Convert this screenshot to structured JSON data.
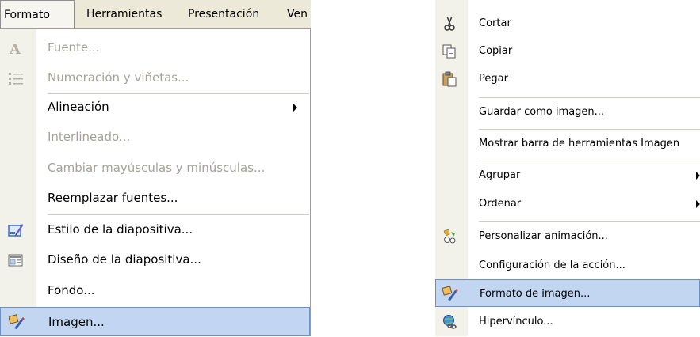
{
  "menubar": {
    "items": [
      "Formato",
      "Herramientas",
      "Presentación",
      "Ven"
    ]
  },
  "formato_menu": {
    "items": [
      {
        "label": "Fuente...",
        "icon": "font-A-icon",
        "disabled": true
      },
      {
        "label": "Numeración y viñetas...",
        "icon": "bullets-icon",
        "disabled": true
      },
      {
        "label": "Alineación",
        "submenu": true
      },
      {
        "label": "Interlineado...",
        "disabled": true
      },
      {
        "label": "Cambiar mayúsculas y minúsculas...",
        "disabled": true
      },
      {
        "label": "Reemplazar fuentes..."
      },
      {
        "label": "Estilo de la diapositiva...",
        "icon": "slide-style-icon"
      },
      {
        "label": "Diseño de la diapositiva...",
        "icon": "slide-layout-icon"
      },
      {
        "label": "Fondo..."
      },
      {
        "label": "Imagen...",
        "icon": "format-picture-icon",
        "highlighted": true
      }
    ]
  },
  "context_menu": {
    "items": [
      {
        "label": "Cortar",
        "icon": "scissors-icon"
      },
      {
        "label": "Copiar",
        "icon": "copy-icon"
      },
      {
        "label": "Pegar",
        "icon": "paste-icon"
      },
      {
        "label": "Guardar como imagen..."
      },
      {
        "label": "Mostrar barra de herramientas Imagen"
      },
      {
        "label": "Agrupar",
        "submenu": true
      },
      {
        "label": "Ordenar",
        "submenu": true
      },
      {
        "label": "Personalizar animación...",
        "icon": "custom-animation-icon"
      },
      {
        "label": "Configuración de la acción..."
      },
      {
        "label": "Formato de imagen...",
        "icon": "format-picture-icon",
        "highlighted": true
      },
      {
        "label": "Hipervínculo...",
        "icon": "hyperlink-icon"
      }
    ]
  },
  "colors": {
    "highlight": "#c2d6f1",
    "highlight_border": "#6d8fc7",
    "disabled_text": "#a6a29a",
    "icon_column": "#f2f1ea"
  }
}
